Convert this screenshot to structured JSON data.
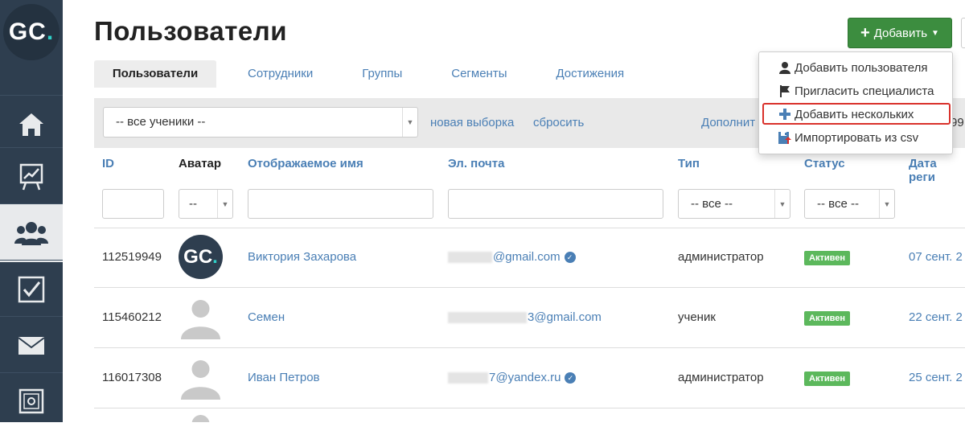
{
  "logo": {
    "text": "GC",
    "dot": "."
  },
  "sidebar": {
    "items": [
      {
        "icon": "home-icon"
      },
      {
        "icon": "chart-icon"
      },
      {
        "icon": "users-icon",
        "active": true
      },
      {
        "icon": "checkbox-icon"
      },
      {
        "icon": "mail-icon"
      },
      {
        "icon": "safe-icon"
      }
    ]
  },
  "page": {
    "title": "Пользователи"
  },
  "tabs": [
    {
      "label": "Пользователи",
      "active": true
    },
    {
      "label": "Сотрудники"
    },
    {
      "label": "Группы"
    },
    {
      "label": "Сегменты"
    },
    {
      "label": "Достижения"
    }
  ],
  "filter": {
    "selection_value": "-- все ученики --",
    "new_selection": "новая выборка",
    "reset": "сбросить",
    "additional": "Дополнит",
    "count_fragment": "99"
  },
  "toolbar": {
    "add_label": "Добавить"
  },
  "add_menu": {
    "items": [
      {
        "label": "Добавить пользователя",
        "icon": "user-icon"
      },
      {
        "label": "Пригласить специалиста",
        "icon": "flag-icon"
      },
      {
        "label": "Добавить нескольких",
        "icon": "plus-icon",
        "highlighted": true
      },
      {
        "label": "Импортировать из csv",
        "icon": "import-icon"
      }
    ]
  },
  "table": {
    "columns": [
      "ID",
      "Аватар",
      "Отображаемое имя",
      "Эл. почта",
      "Тип",
      "Статус",
      "Дата реги"
    ],
    "filters": {
      "avatar": "--",
      "type": "-- все --",
      "status": "-- все --"
    },
    "rows": [
      {
        "id": "112519949",
        "avatar": "gc",
        "name": "Виктория Захарова",
        "email": "@gmail.com",
        "verified": true,
        "type": "администратор",
        "status": "Активен",
        "date": "07 сент. 2"
      },
      {
        "id": "115460212",
        "avatar": "placeholder",
        "name": "Семен",
        "email": "3@gmail.com",
        "verified": false,
        "type": "ученик",
        "status": "Активен",
        "date": "22 сент. 2"
      },
      {
        "id": "116017308",
        "avatar": "placeholder",
        "name": "Иван Петров",
        "email": "7@yandex.ru",
        "verified": true,
        "type": "администратор",
        "status": "Активен",
        "date": "25 сент. 2"
      }
    ]
  },
  "colors": {
    "sidebar": "#2e3e4f",
    "accent": "#4a7fb5",
    "add_button": "#3c8d3f",
    "badge": "#5cb85c",
    "highlight": "#d9312b"
  }
}
